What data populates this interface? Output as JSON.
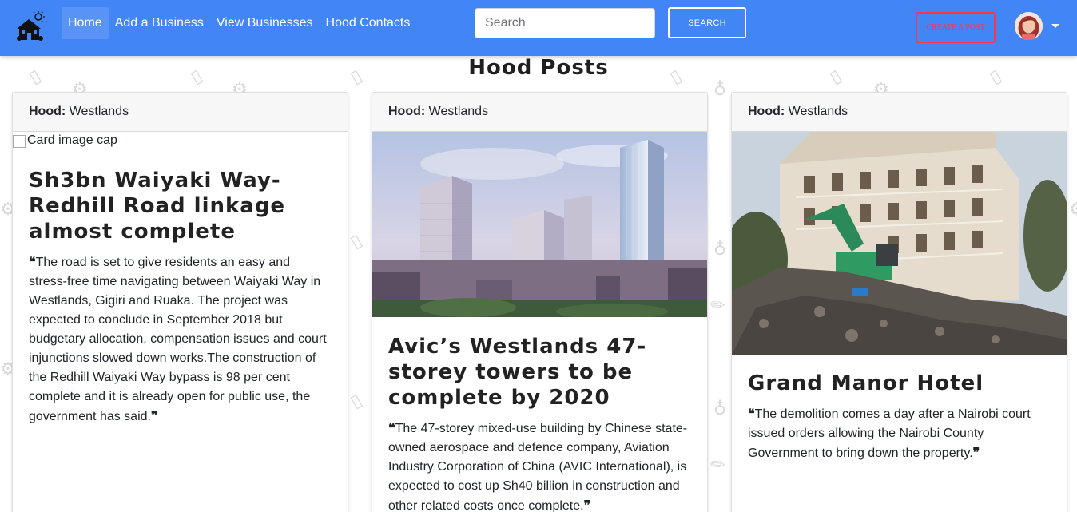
{
  "navbar": {
    "links": [
      "Home",
      "Add a Business",
      "View Businesses",
      "Hood Contacts"
    ],
    "search_placeholder": "Search",
    "search_button": "SEARCH",
    "create_post_button": "CREATE A POST"
  },
  "page_title": "Hood Posts",
  "cards": [
    {
      "hood_label": "Hood:",
      "hood_value": "Westlands",
      "image_alt": "Card image cap",
      "title": "Sh3bn Waiyaki Way-Redhill Road linkage almost complete",
      "text": "The road is set to give residents an easy and stress-free time navigating between Waiyaki Way in Westlands, Gigiri and Ruaka. The project was expected to conclude in September 2018 but budgetary allocation, compensation issues and court injunctions slowed down works.The construction of the Redhill Waiyaki Way bypass is 98 per cent complete and it is already open for public use, the government has said."
    },
    {
      "hood_label": "Hood:",
      "hood_value": "Westlands",
      "title": "Avic’s Westlands 47-storey towers to be complete by 2020",
      "text": "The 47-storey mixed-use building by Chinese state-owned aerospace and defence company, Aviation Industry Corporation of China (AVIC International), is expected to cost up Sh40 billion in construction and other related costs once complete."
    },
    {
      "hood_label": "Hood:",
      "hood_value": "Westlands",
      "title": "Grand Manor Hotel",
      "text": "The demolition comes a day after a Nairobi court issued orders allowing the Nairobi County Government to bring down the property."
    }
  ],
  "quote_open": "❝",
  "quote_close": "❞",
  "colors": {
    "navbar": "#4285f4",
    "create_post": "#ff3547",
    "card_header": "#f7f7f7"
  }
}
